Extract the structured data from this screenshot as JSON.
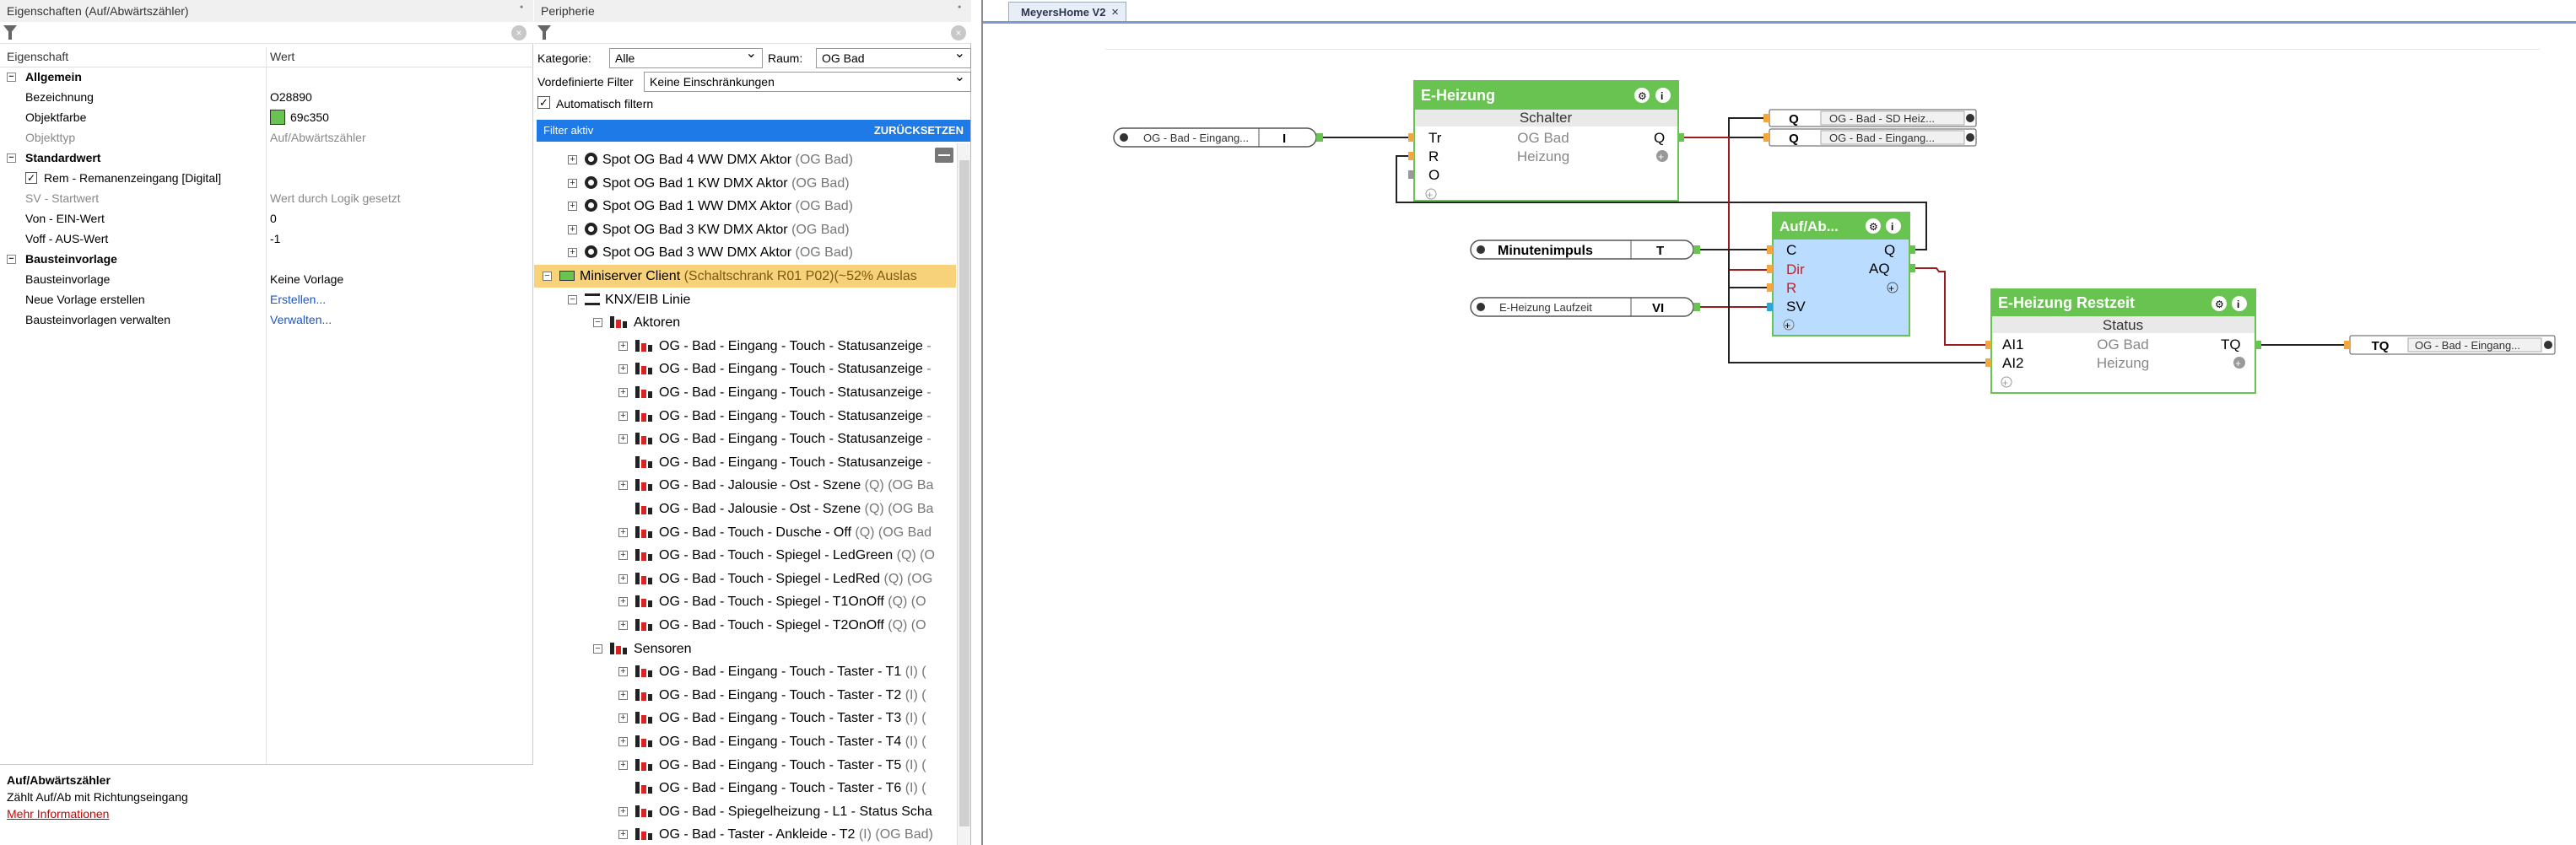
{
  "properties_panel": {
    "title": "Eigenschaften (Auf/Abwärtszähler)",
    "pin": "ᐩ",
    "col_property": "Eigenschaft",
    "col_value": "Wert",
    "rows": [
      {
        "kind": "group",
        "label": "Allgemein"
      },
      {
        "kind": "row",
        "label": "Bezeichnung",
        "value": "O28890"
      },
      {
        "kind": "row",
        "label": "Objektfarbe",
        "value": "69c350",
        "swatch": "#69c350"
      },
      {
        "kind": "row",
        "label": "Objekttyp",
        "value": "Auf/Abwärtszähler",
        "muted": true
      },
      {
        "kind": "group",
        "label": "Standardwert"
      },
      {
        "kind": "row",
        "label": "Rem - Remanenzeingang [Digital]",
        "value": "",
        "checkbox": true
      },
      {
        "kind": "row",
        "label": "SV - Startwert",
        "value": "Wert durch Logik gesetzt",
        "muted": true
      },
      {
        "kind": "row",
        "label": "Von - EIN-Wert",
        "value": "0"
      },
      {
        "kind": "row",
        "label": "Voff - AUS-Wert",
        "value": "-1"
      },
      {
        "kind": "group",
        "label": "Bausteinvorlage"
      },
      {
        "kind": "row",
        "label": "Bausteinvorlage",
        "value": "Keine Vorlage"
      },
      {
        "kind": "row",
        "label": "Neue Vorlage erstellen",
        "value": "Erstellen...",
        "link": true
      },
      {
        "kind": "row",
        "label": "Bausteinvorlagen verwalten",
        "value": "Verwalten...",
        "link": true
      }
    ],
    "help_title": "Auf/Abwärtszähler",
    "help_text": "Zählt Auf/Ab mit Richtungseingang",
    "help_link": "Mehr Informationen"
  },
  "peripherals_panel": {
    "title": "Peripherie",
    "kategorie_label": "Kategorie:",
    "kategorie_value": "Alle",
    "raum_label": "Raum:",
    "raum_value": "OG Bad",
    "predefined_label": "Vordefinierte Filter",
    "predefined_value": "Keine Einschränkungen",
    "auto_filter_label": "Automatisch filtern",
    "filter_active": "Filter aktiv",
    "reset": "ZURÜCKSETZEN",
    "tree": [
      {
        "indent": 1,
        "box": "+",
        "icon": "dmx",
        "label": "Spot OG Bad 4 WW DMX Aktor",
        "suffix": " (OG Bad)"
      },
      {
        "indent": 1,
        "box": "+",
        "icon": "dmx",
        "label": "Spot OG Bad 1 KW DMX Aktor",
        "suffix": " (OG Bad)"
      },
      {
        "indent": 1,
        "box": "+",
        "icon": "dmx",
        "label": "Spot OG Bad 1 WW DMX Aktor",
        "suffix": " (OG Bad)"
      },
      {
        "indent": 1,
        "box": "+",
        "icon": "dmx",
        "label": "Spot OG Bad 3 KW DMX Aktor",
        "suffix": " (OG Bad)"
      },
      {
        "indent": 1,
        "box": "+",
        "icon": "dmx",
        "label": "Spot OG Bad 3 WW DMX Aktor",
        "suffix": " (OG Bad)"
      },
      {
        "indent": 0,
        "box": "-",
        "icon": "miniserver",
        "label": "Miniserver Client",
        "suffix": " (Schaltschrank R01 P02)(~52% Auslas",
        "highlight": true
      },
      {
        "indent": 1,
        "box": "-",
        "icon": "knxline",
        "label": "KNX/EIB Linie",
        "suffix": ""
      },
      {
        "indent": 2,
        "box": "-",
        "icon": "knx",
        "label": "Aktoren",
        "suffix": ""
      },
      {
        "indent": 3,
        "box": "+",
        "icon": "knx",
        "label": "OG - Bad - Eingang - Touch - Statusanzeige",
        "suffix": " -"
      },
      {
        "indent": 3,
        "box": "+",
        "icon": "knx",
        "label": "OG - Bad - Eingang - Touch - Statusanzeige",
        "suffix": " -"
      },
      {
        "indent": 3,
        "box": "+",
        "icon": "knx",
        "label": "OG - Bad - Eingang - Touch - Statusanzeige",
        "suffix": " -"
      },
      {
        "indent": 3,
        "box": "+",
        "icon": "knx",
        "label": "OG - Bad - Eingang - Touch - Statusanzeige",
        "suffix": " -"
      },
      {
        "indent": 3,
        "box": "+",
        "icon": "knx",
        "label": "OG - Bad - Eingang - Touch - Statusanzeige",
        "suffix": " -"
      },
      {
        "indent": 3,
        "box": "",
        "icon": "knx",
        "label": "OG - Bad - Eingang - Touch - Statusanzeige",
        "suffix": " -"
      },
      {
        "indent": 3,
        "box": "+",
        "icon": "knx",
        "label": "OG - Bad - Jalousie - Ost - Szene",
        "suffix": " (Q) (OG Ba"
      },
      {
        "indent": 3,
        "box": "",
        "icon": "knx",
        "label": "OG - Bad - Jalousie - Ost - Szene",
        "suffix": " (Q) (OG Ba"
      },
      {
        "indent": 3,
        "box": "+",
        "icon": "knx",
        "label": "OG - Bad - Touch - Dusche - Off",
        "suffix": " (Q) (OG Bad"
      },
      {
        "indent": 3,
        "box": "+",
        "icon": "knx",
        "label": "OG - Bad - Touch - Spiegel - LedGreen",
        "suffix": " (Q) (O"
      },
      {
        "indent": 3,
        "box": "+",
        "icon": "knx",
        "label": "OG - Bad - Touch - Spiegel - LedRed",
        "suffix": " (Q) (OG"
      },
      {
        "indent": 3,
        "box": "+",
        "icon": "knx",
        "label": "OG - Bad - Touch - Spiegel - T1OnOff",
        "suffix": " (Q) (O"
      },
      {
        "indent": 3,
        "box": "+",
        "icon": "knx",
        "label": "OG - Bad - Touch - Spiegel - T2OnOff",
        "suffix": " (Q) (O"
      },
      {
        "indent": 2,
        "box": "-",
        "icon": "knx",
        "label": "Sensoren",
        "suffix": ""
      },
      {
        "indent": 3,
        "box": "+",
        "icon": "knx",
        "label": "OG - Bad - Eingang - Touch - Taster - T1",
        "suffix": " (I) ("
      },
      {
        "indent": 3,
        "box": "+",
        "icon": "knx",
        "label": "OG - Bad - Eingang - Touch - Taster - T2",
        "suffix": " (I) ("
      },
      {
        "indent": 3,
        "box": "+",
        "icon": "knx",
        "label": "OG - Bad - Eingang - Touch - Taster - T3",
        "suffix": " (I) ("
      },
      {
        "indent": 3,
        "box": "+",
        "icon": "knx",
        "label": "OG - Bad - Eingang - Touch - Taster - T4",
        "suffix": " (I) ("
      },
      {
        "indent": 3,
        "box": "+",
        "icon": "knx",
        "label": "OG - Bad - Eingang - Touch - Taster - T5",
        "suffix": " (I) ("
      },
      {
        "indent": 3,
        "box": "",
        "icon": "knx",
        "label": "OG - Bad - Eingang - Touch - Taster - T6",
        "suffix": " (I) ("
      },
      {
        "indent": 3,
        "box": "+",
        "icon": "knx",
        "label": "OG - Bad - Spiegelheizung - L1 - Status Scha",
        "suffix": ""
      },
      {
        "indent": 3,
        "box": "+",
        "icon": "knx",
        "label": "OG - Bad - Taster - Ankleide - T2",
        "suffix": " (I) (OG Bad)"
      }
    ]
  },
  "canvas": {
    "tab_title": "MeyersHome V2",
    "tab_close": "×",
    "colors": {
      "block_header": "#69c350",
      "block_body": "#ffffff",
      "counter_body": "#b9dcff",
      "wire": "#222222",
      "red_wire": "#9b1c1c",
      "dir_text": "#c81e1e"
    },
    "eheizung": {
      "title": "E-Heizung",
      "subtitle": "Schalter",
      "inputs": [
        "Tr",
        "R",
        "O"
      ],
      "outputs": [
        "Q"
      ],
      "mid1": "OG Bad",
      "mid2": "Heizung"
    },
    "counter": {
      "title": "Auf/Ab...",
      "inputs": [
        "C",
        "Dir",
        "R",
        "SV"
      ],
      "outputs": [
        "Q",
        "AQ"
      ]
    },
    "restzeit": {
      "title": "E-Heizung Restzeit",
      "subtitle": "Status",
      "inputs": [
        "AI1",
        "AI2"
      ],
      "outputs": [
        "TQ"
      ],
      "mid1": "OG Bad",
      "mid2": "Heizung"
    },
    "input_eingang": {
      "label": "OG - Bad - Eingang...",
      "port": "I"
    },
    "minutenimpuls": {
      "label": "Minutenimpuls",
      "port": "T"
    },
    "laufzeit": {
      "label": "E-Heizung Laufzeit",
      "port": "VI"
    },
    "out_sd": {
      "port": "Q",
      "label": "OG - Bad - SD Heiz..."
    },
    "out_eingang": {
      "port": "Q",
      "label": "OG - Bad - Eingang..."
    },
    "out_tq": {
      "port": "TQ",
      "label": "OG - Bad - Eingang..."
    }
  }
}
